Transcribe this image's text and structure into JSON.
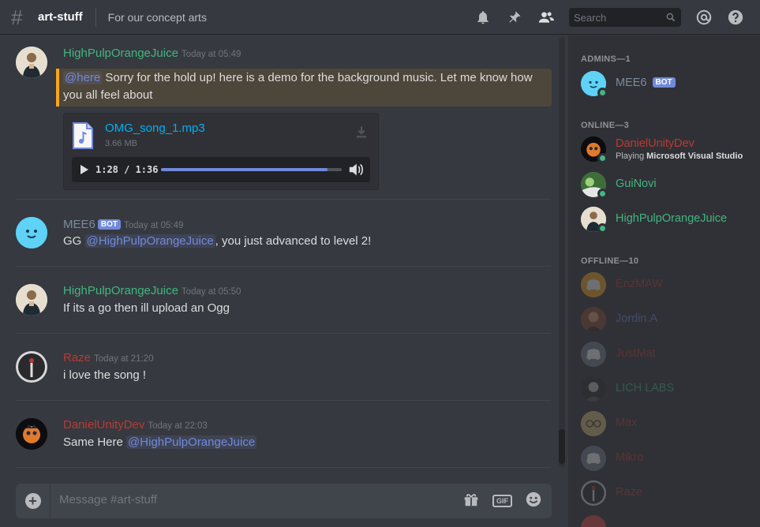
{
  "header": {
    "channel_name": "art-stuff",
    "topic": "For our concept arts",
    "search_placeholder": "Search"
  },
  "messages": [
    {
      "author": "HighPulpOrangeJuice",
      "author_color": "#43b581",
      "time": "Today at 05:49",
      "mention": "@here",
      "text": " Sorry for the hold up! here is a demo for the background music. Let me know how you all feel about",
      "attachment": {
        "filename": "OMG_song_1.mp3",
        "size": "3.66 MB",
        "time_display": "1:28 / 1:36",
        "progress": 0.92
      }
    },
    {
      "author": "MEE6",
      "author_color": "#7c8a9e",
      "bot_tag": "BOT",
      "time": "Today at 05:49",
      "text_before": "GG ",
      "mention": "@HighPulpOrangeJuice",
      "text_after": ", you just advanced to level 2!"
    },
    {
      "author": "HighPulpOrangeJuice",
      "author_color": "#43b581",
      "time": "Today at 05:50",
      "text": "If its a go then ill upload an Ogg"
    },
    {
      "author": "Raze",
      "author_color": "#b83b34",
      "time": "Today at 21:20",
      "text": "i love the song !"
    },
    {
      "author": "DanielUnityDev",
      "author_color": "#b83b34",
      "time": "Today at 22:03",
      "text_before": "Same Here ",
      "mention": "@HighPulpOrangeJuice"
    }
  ],
  "composer": {
    "placeholder": "Message #art-stuff",
    "gif_label": "GIF"
  },
  "member_list": {
    "admins_header": "ADMINS—1",
    "admins": [
      {
        "name": "MEE6",
        "color": "#7c8a9e",
        "bot_tag": "BOT"
      }
    ],
    "online_header": "ONLINE—3",
    "online": [
      {
        "name": "DanielUnityDev",
        "color": "#b83b34",
        "activity_prefix": "Playing ",
        "activity": "Microsoft Visual Studio"
      },
      {
        "name": "GuiNovi",
        "color": "#43b581"
      },
      {
        "name": "HighPulpOrangeJuice",
        "color": "#43b581"
      }
    ],
    "offline_header": "OFFLINE—10",
    "offline": [
      {
        "name": "EnzMAW",
        "color": "#b83b34"
      },
      {
        "name": "Jordin.A",
        "color": "#7289da"
      },
      {
        "name": "JustMat",
        "color": "#b83b34"
      },
      {
        "name": "LICH LABS",
        "color": "#43b581"
      },
      {
        "name": "Max",
        "color": "#b83b34"
      },
      {
        "name": "Mikro",
        "color": "#b83b34"
      },
      {
        "name": "Raze",
        "color": "#b83b34"
      }
    ]
  }
}
